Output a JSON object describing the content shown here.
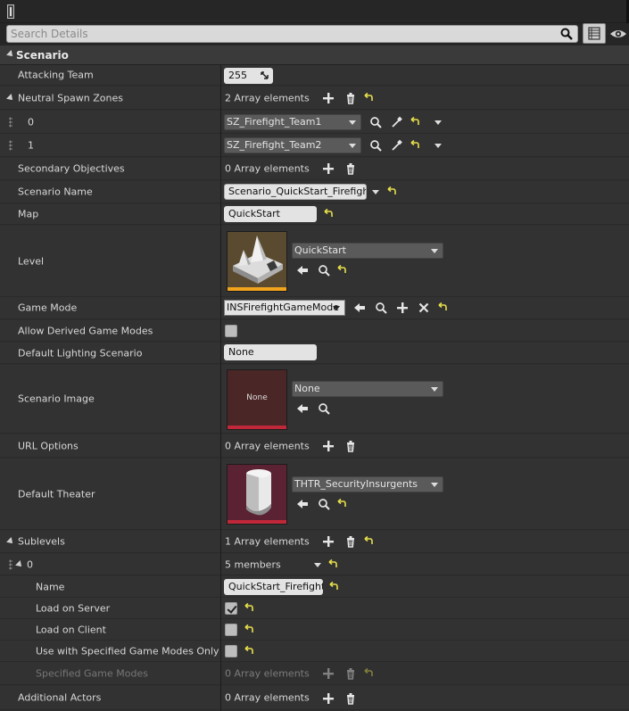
{
  "search": {
    "placeholder": "Search Details"
  },
  "section": {
    "title": "Scenario"
  },
  "rows": {
    "attacking_team": {
      "label": "Attacking Team",
      "value": "255"
    },
    "neutral_spawn_zones": {
      "label": "Neutral Spawn Zones",
      "count": "2 Array elements",
      "items": [
        {
          "index": "0",
          "value": "SZ_Firefight_Team1"
        },
        {
          "index": "1",
          "value": "SZ_Firefight_Team2"
        }
      ]
    },
    "secondary_objectives": {
      "label": "Secondary Objectives",
      "count": "0 Array elements"
    },
    "scenario_name": {
      "label": "Scenario Name",
      "value": "Scenario_QuickStart_Firefight"
    },
    "map": {
      "label": "Map",
      "value": "QuickStart"
    },
    "level": {
      "label": "Level",
      "value": "QuickStart"
    },
    "game_mode": {
      "label": "Game Mode",
      "value": "INSFirefightGameMode"
    },
    "allow_derived": {
      "label": "Allow Derived Game Modes"
    },
    "default_lighting": {
      "label": "Default Lighting Scenario",
      "value": "None"
    },
    "scenario_image": {
      "label": "Scenario Image",
      "value": "None",
      "thumb_label": "None"
    },
    "url_options": {
      "label": "URL Options",
      "count": "0 Array elements"
    },
    "default_theater": {
      "label": "Default Theater",
      "value": "THTR_SecurityInsurgents"
    },
    "sublevels": {
      "label": "Sublevels",
      "count": "1 Array elements",
      "item": {
        "index": "0",
        "members": "5 members",
        "name_label": "Name",
        "name_value": "QuickStart_Firefight",
        "load_server_label": "Load on Server",
        "load_client_label": "Load on Client",
        "use_specified_label": "Use with Specified Game Modes Only",
        "specified_modes_label": "Specified Game Modes",
        "specified_modes_count": "0 Array elements"
      }
    },
    "additional_actors": {
      "label": "Additional Actors",
      "count": "0 Array elements"
    }
  },
  "colors": {
    "accent_orange": "#f2a51c",
    "reset_yellow": "#e8e04a",
    "image_bar_red": "#c0283a"
  }
}
